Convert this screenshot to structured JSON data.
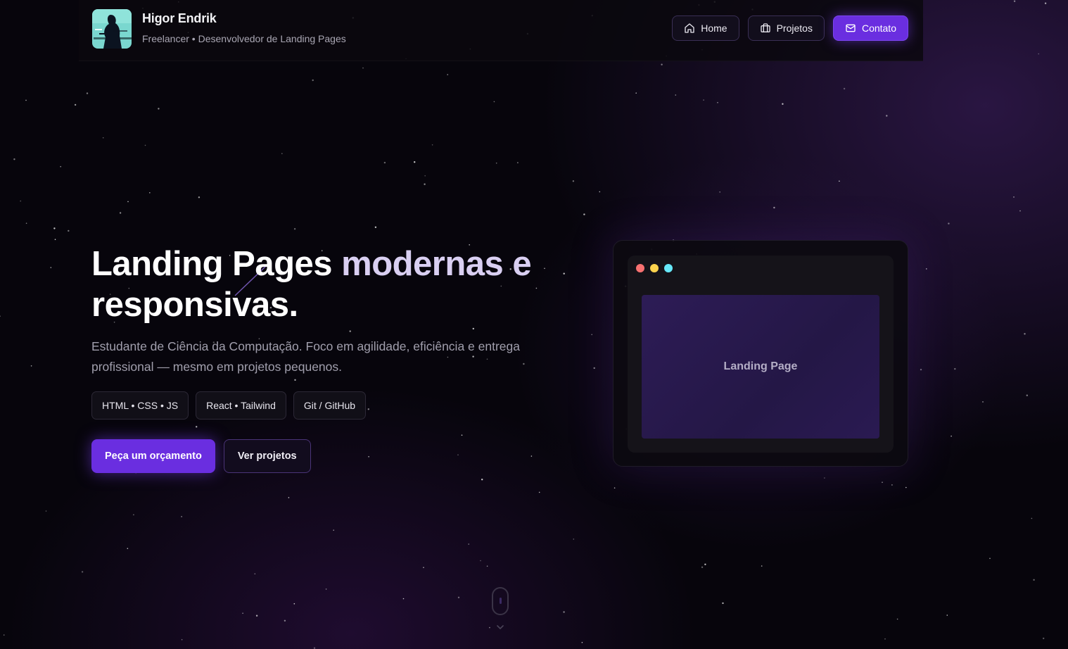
{
  "header": {
    "name": "Higor Endrik",
    "subtitle": "Freelancer • Desenvolvedor de Landing Pages",
    "avatar_icon": "avatar-photo",
    "nav": [
      {
        "label": "Home",
        "icon": "home-icon"
      },
      {
        "label": "Projetos",
        "icon": "briefcase-icon"
      },
      {
        "label": "Contato",
        "icon": "mail-icon",
        "active": true
      }
    ]
  },
  "hero": {
    "title_plain": "Landing Pages ",
    "title_accent": "modernas e",
    "title_line2": "responsivas.",
    "description": "Estudante de Ciência da Computação. Foco em agilidade, eficiência e entrega profissional — mesmo em projetos pequenos.",
    "tags": [
      "HTML • CSS • JS",
      "React • Tailwind",
      "Git / GitHub"
    ],
    "primary_cta": "Peça um orçamento",
    "secondary_cta": "Ver projetos"
  },
  "mockup": {
    "label": "Landing Page",
    "dots": [
      "#f87171",
      "#fcd34d",
      "#67e8f9"
    ]
  },
  "colors": {
    "accent": "#6a2ee0",
    "background": "#07050c"
  }
}
